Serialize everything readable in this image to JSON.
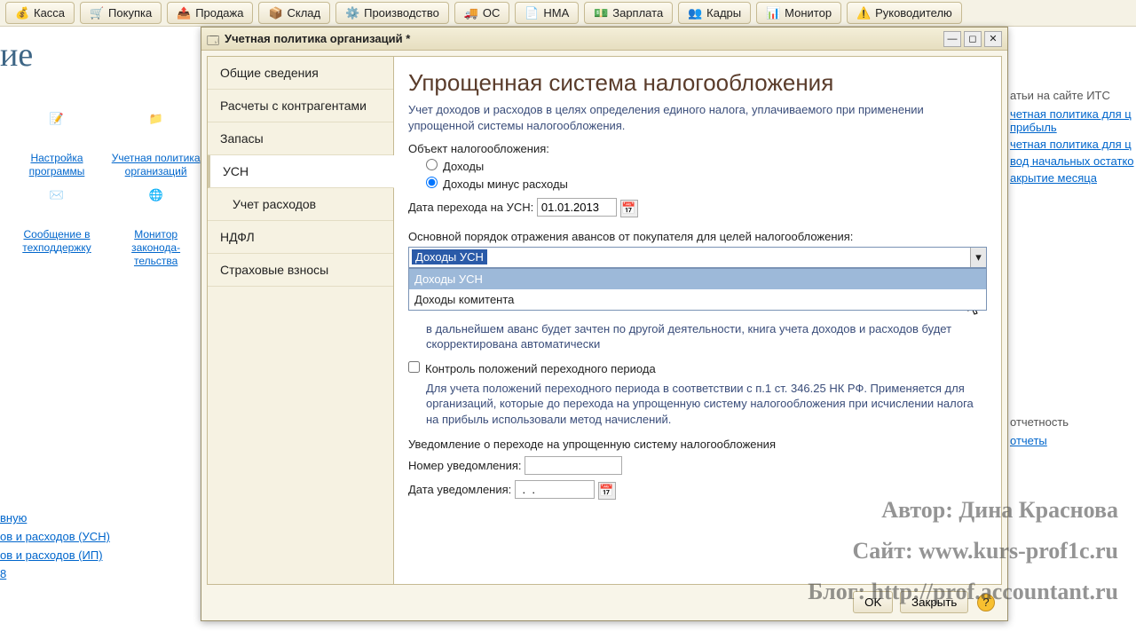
{
  "toolbar": [
    "Касса",
    "Покупка",
    "Продажа",
    "Склад",
    "Производство",
    "ОС",
    "НМА",
    "Зарплата",
    "Кадры",
    "Монитор",
    "Руководителю"
  ],
  "bgTitle": "ие",
  "desktopIcons": {
    "settings": "Настройка программы",
    "policy": "Учетная политика организаций",
    "support": "Сообщение в техподдержку",
    "lawmonitor": "Монитор законода- тельства"
  },
  "leftLinks": [
    "вную",
    "ов и расходов (УСН)",
    "ов и расходов (ИП)",
    "8"
  ],
  "side": {
    "header": "атьи на сайте ИТС",
    "links": [
      "четная политика для ц прибыль",
      "четная политика для ц",
      "вод начальных остатко",
      "акрытие месяца"
    ],
    "section2": "отчетность",
    "link2": "отчеты"
  },
  "window": {
    "title": "Учетная политика организаций *",
    "tabs": [
      "Общие сведения",
      "Расчеты с контрагентами",
      "Запасы",
      "УСН",
      "Учет расходов",
      "НДФЛ",
      "Страховые взносы"
    ],
    "activeTab": 3,
    "heading": "Упрощенная система налогообложения",
    "intro": "Учет доходов и расходов в целях определения единого налога, уплачиваемого при применении упрощенной системы налогообложения.",
    "objLabel": "Объект налогообложения:",
    "radio1": "Доходы",
    "radio2": "Доходы минус расходы",
    "dateLabel": "Дата перехода на УСН:",
    "dateValue": "01.01.2013",
    "avansLabel": "Основной порядок отражения авансов от покупателя для целей налогообложения:",
    "comboValue": "Доходы УСН",
    "comboOptions": [
      "Доходы УСН",
      "Доходы комитента"
    ],
    "hint1": "в дальнейшем аванс будет зачтен по другой деятельности, книга учета доходов и расходов будет скорректирована автоматически",
    "chkLabel": "Контроль положений переходного периода",
    "hint2": "Для учета положений переходного периода в соответствии с п.1 ст. 346.25 НК РФ. Применяется для организаций, которые до перехода на упрощенную систему налогообложения при исчислении налога на прибыль использовали метод начислений.",
    "notifTitle": "Уведомление о переходе на упрощенную систему налогообложения",
    "notifNum": "Номер уведомления:",
    "notifDate": "Дата уведомления:",
    "notifDateVal": " .  .    ",
    "ok": "OK",
    "close": "Закрыть"
  },
  "watermarks": {
    "author": "Автор: Дина Краснова",
    "site": "Сайт: www.kurs-prof1c.ru",
    "blog": "Блог: http://prof.accountant.ru"
  }
}
